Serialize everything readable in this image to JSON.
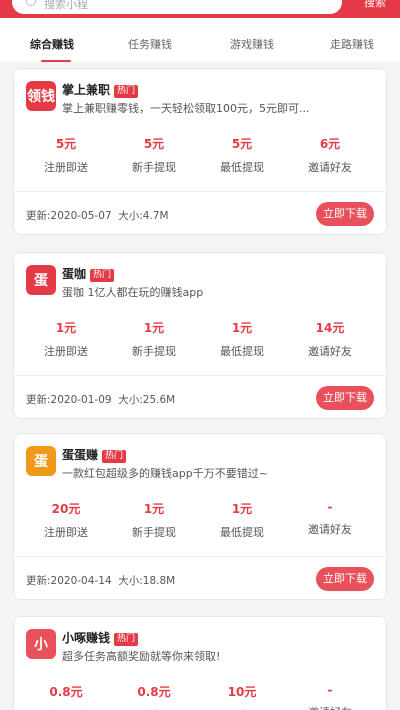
{
  "search": {
    "placeholder": "搜索小程",
    "button": "搜索"
  },
  "tabs": [
    {
      "label": "综合赚钱"
    },
    {
      "label": "任务赚钱"
    },
    {
      "label": "游戏赚钱"
    },
    {
      "label": "走路赚钱"
    }
  ],
  "stat_labels": {
    "register": "注册即送",
    "newbie": "新手提现",
    "min": "最低提现",
    "invite": "邀请好友"
  },
  "download_label": "立即下载",
  "hot_label": "热门",
  "apps": [
    {
      "icon_text": "领钱",
      "name": "掌上兼职",
      "desc": "掌上兼职赚零钱，一天轻松领取100元，5元即可...",
      "register": "5元",
      "newbie": "5元",
      "min": "5元",
      "invite": "6元",
      "updated": "更新:2020-05-07",
      "size": "大小:4.7M"
    },
    {
      "icon_text": "蛋",
      "name": "蛋咖",
      "desc": "蛋咖 1亿人都在玩的赚钱app",
      "register": "1元",
      "newbie": "1元",
      "min": "1元",
      "invite": "14元",
      "updated": "更新:2020-01-09",
      "size": "大小:25.6M"
    },
    {
      "icon_text": "蛋",
      "name": "蛋蛋赚",
      "desc": "一款红包超级多的赚钱app千万不要错过~",
      "register": "20元",
      "newbie": "1元",
      "min": "1元",
      "invite": "-",
      "updated": "更新:2020-04-14",
      "size": "大小:18.8M"
    },
    {
      "icon_text": "小",
      "name": "小啄赚钱",
      "desc": "超多任务高额奖励就等你来领取!",
      "register": "0.8元",
      "newbie": "0.8元",
      "min": "10元",
      "invite": "-",
      "updated": "",
      "size": ""
    }
  ]
}
